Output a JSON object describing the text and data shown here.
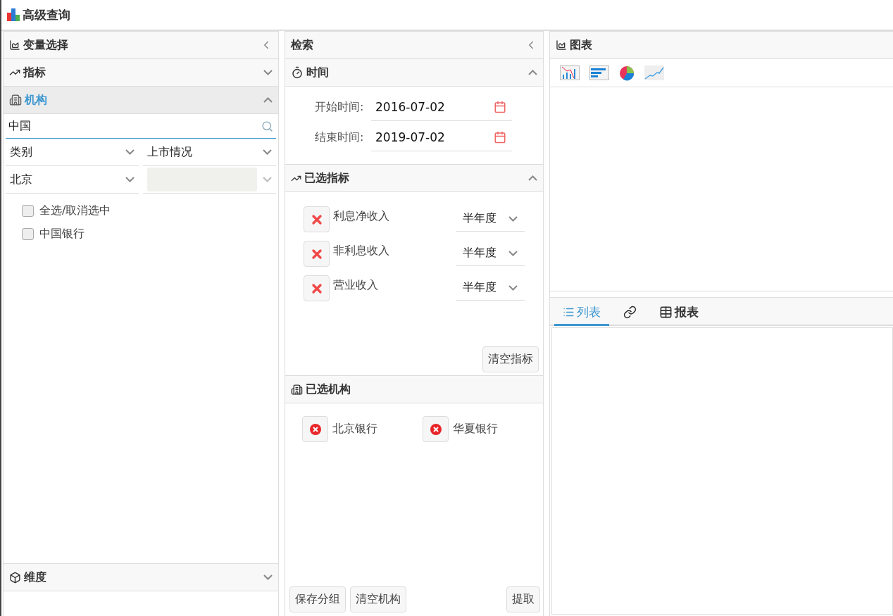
{
  "window": {
    "title": "高级查询"
  },
  "variable_panel": {
    "title": "变量选择",
    "indicator_section": {
      "title": "指标",
      "expanded": false
    },
    "institution_section": {
      "title": "机构",
      "expanded": true,
      "search": {
        "value": "中国"
      },
      "filters": [
        {
          "value": "类别",
          "disabled": false
        },
        {
          "value": "上市情况",
          "disabled": false
        },
        {
          "value": "北京",
          "disabled": false
        },
        {
          "disabled": true
        }
      ],
      "checkboxes": [
        {
          "label": "全选/取消选中",
          "checked": false
        },
        {
          "label": "中国银行",
          "checked": false
        }
      ]
    },
    "dimension_section": {
      "title": "维度",
      "expanded": false
    }
  },
  "search_panel": {
    "title": "检索",
    "time_section": {
      "title": "时间",
      "expanded": true,
      "fields": [
        {
          "label": "开始时间:",
          "value": "2016-07-02"
        },
        {
          "label": "结束时间:",
          "value": "2019-07-02"
        }
      ]
    },
    "indicators_section": {
      "title": "已选指标",
      "expanded": true,
      "items": [
        {
          "name": "利息净收入",
          "period": "半年度"
        },
        {
          "name": "非利息收入",
          "period": "半年度"
        },
        {
          "name": "营业收入",
          "period": "半年度"
        }
      ],
      "clear_button": "清空指标"
    },
    "institutions_section": {
      "title": "已选机构",
      "items": [
        "北京银行",
        "华夏银行"
      ]
    },
    "buttons": [
      {
        "label": "保存分组"
      },
      {
        "label": "清空机构"
      },
      {
        "label": "提取"
      }
    ]
  },
  "chart_panel": {
    "title": "图表",
    "chart_types": [
      {
        "kind": "column"
      },
      {
        "kind": "bar"
      },
      {
        "kind": "pie"
      },
      {
        "kind": "line"
      }
    ]
  },
  "tabs": [
    {
      "kind": "list",
      "label": "列表",
      "selected": true
    },
    {
      "kind": "link",
      "selected": false
    },
    {
      "kind": "table",
      "label": "报表",
      "selected": false
    }
  ]
}
